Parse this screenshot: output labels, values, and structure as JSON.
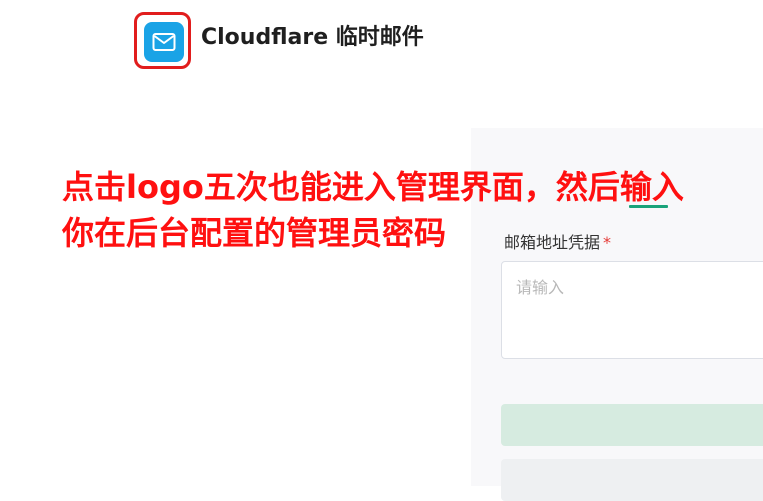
{
  "header": {
    "logo_icon": "mail-icon",
    "title": "Cloudflare 临时邮件"
  },
  "annotation": {
    "line1": "点击logo五次也能进入管理界面，然后输入",
    "line2": "你在后台配置的管理员密码"
  },
  "form": {
    "credential_label": "邮箱地址凭据",
    "required_mark": "*",
    "credential_placeholder": "请输入",
    "credential_value": ""
  },
  "colors": {
    "logo_bg": "#1aa3e6",
    "highlight_border": "#e11d1d",
    "annotation_text": "#ff1010",
    "primary_button": "#d6ebe0",
    "secondary_button": "#eef0f2"
  }
}
